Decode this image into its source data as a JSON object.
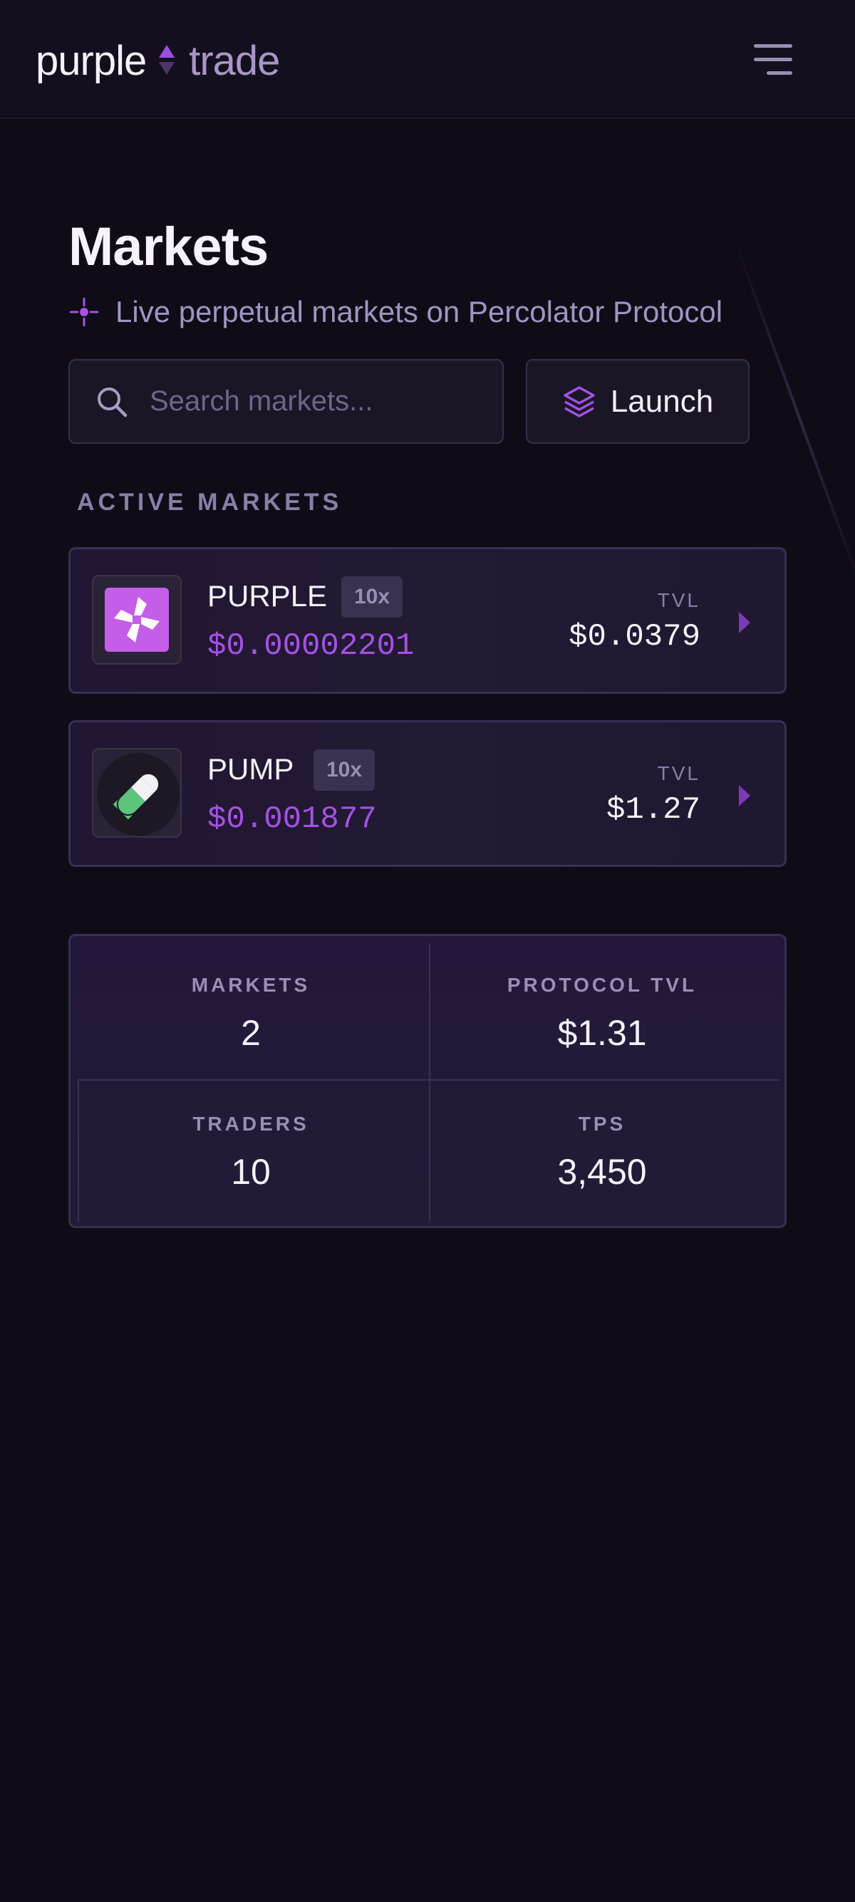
{
  "header": {
    "logo_word1": "purple",
    "logo_word2": "trade",
    "menu_icon": "hamburger-menu-icon"
  },
  "page": {
    "title": "Markets",
    "subtitle": "Live perpetual markets on Percolator Protocol",
    "subtitle_icon": "crosshair-icon"
  },
  "search": {
    "placeholder": "Search markets...",
    "value": ""
  },
  "launch": {
    "label": "Launch",
    "icon": "layers-icon"
  },
  "section_label": "ACTIVE MARKETS",
  "markets": [
    {
      "name": "PURPLE",
      "leverage": "10x",
      "price": "$0.00002201",
      "tvl_label": "TVL",
      "tvl": "$0.0379",
      "icon": "pinwheel-token-icon"
    },
    {
      "name": "PUMP",
      "leverage": "10x",
      "price": "$0.001877",
      "tvl_label": "TVL",
      "tvl": "$1.27",
      "icon": "pill-token-icon"
    }
  ],
  "stats": {
    "markets_label": "MARKETS",
    "markets_value": "2",
    "tvl_label": "PROTOCOL TVL",
    "tvl_value": "$1.31",
    "traders_label": "TRADERS",
    "traders_value": "10",
    "tps_label": "TPS",
    "tps_value": "3,450"
  },
  "colors": {
    "background": "#0f0c18",
    "accent": "#a452e3",
    "card": "#211633",
    "muted": "#8a7ea6"
  }
}
